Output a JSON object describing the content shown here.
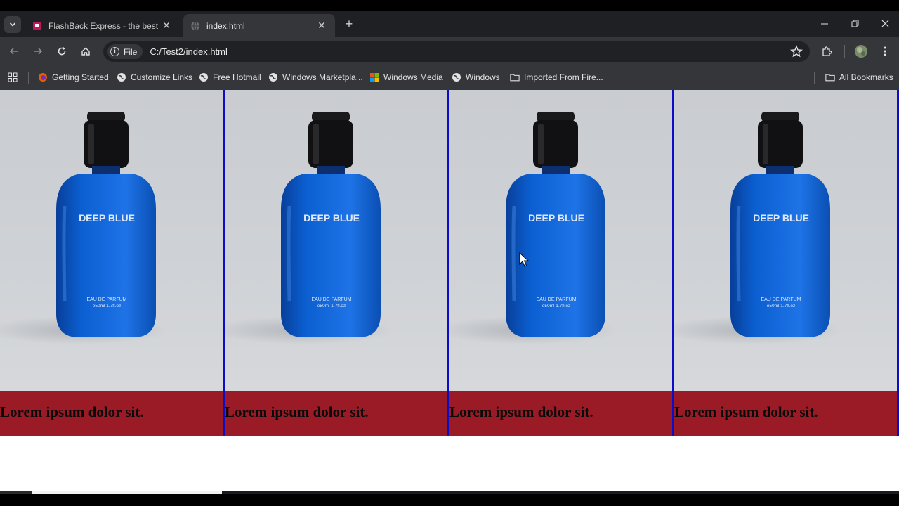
{
  "browser": {
    "tabs": [
      {
        "title": "FlashBack Express - the best fre",
        "active": false,
        "favicon": "flashback-icon"
      },
      {
        "title": "index.html",
        "active": true,
        "favicon": "globe-icon"
      }
    ],
    "new_tab_label": "+",
    "address": {
      "chip_label": "File",
      "url": "C:/Test2/index.html"
    },
    "bookmarks": [
      {
        "label": "Getting Started",
        "icon": "firefox-icon"
      },
      {
        "label": "Customize Links",
        "icon": "globe-icon"
      },
      {
        "label": "Free Hotmail",
        "icon": "globe-icon"
      },
      {
        "label": "Windows Marketpla...",
        "icon": "globe-icon"
      },
      {
        "label": "Windows Media",
        "icon": "windows-logo-icon"
      },
      {
        "label": "Windows",
        "icon": "globe-icon"
      },
      {
        "label": "Imported From Fire...",
        "icon": "folder-icon"
      }
    ],
    "all_bookmarks_label": "All Bookmarks"
  },
  "products": [
    {
      "bottle_brand": "DEEP BLUE",
      "bottle_type": "EAU DE PARFUM",
      "bottle_volume": "e50ml     1.7fl.oz",
      "caption": "Lorem ipsum dolor sit."
    },
    {
      "bottle_brand": "DEEP BLUE",
      "bottle_type": "EAU DE PARFUM",
      "bottle_volume": "e50ml     1.7fl.oz",
      "caption": "Lorem ipsum dolor sit."
    },
    {
      "bottle_brand": "DEEP BLUE",
      "bottle_type": "EAU DE PARFUM",
      "bottle_volume": "e50ml     1.7fl.oz",
      "caption": "Lorem ipsum dolor sit."
    },
    {
      "bottle_brand": "DEEP BLUE",
      "bottle_type": "EAU DE PARFUM",
      "bottle_volume": "e50ml     1.7fl.oz",
      "caption": "Lorem ipsum dolor sit."
    }
  ],
  "colors": {
    "caption_bg": "#9a1a26",
    "card_border": "#0d0dc8",
    "bottle_blue": "#0b5fd1"
  }
}
